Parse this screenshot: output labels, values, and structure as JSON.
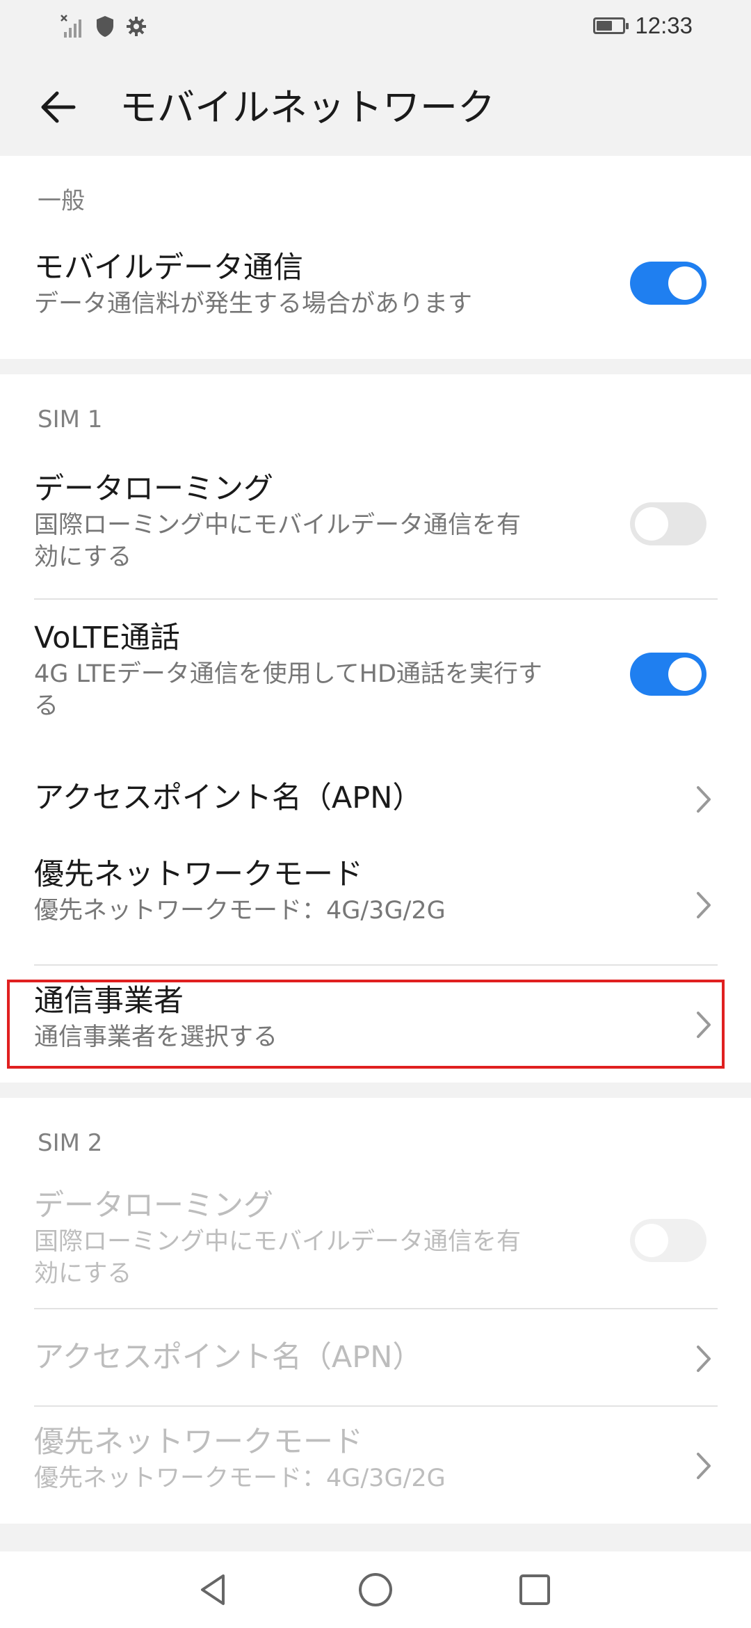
{
  "status_bar": {
    "time": "12:33",
    "icons": [
      "no-signal-icon",
      "shield-icon",
      "gear-icon",
      "battery-icon"
    ]
  },
  "header": {
    "back_icon": "arrow-back-icon",
    "title": "モバイルネットワーク"
  },
  "sections": {
    "general": {
      "title": "一般",
      "mobile_data": {
        "title": "モバイルデータ通信",
        "subtitle": "データ通信料が発生する場合があります",
        "toggle": "on"
      }
    },
    "sim1": {
      "title": "SIM 1",
      "data_roaming": {
        "title": "データローミング",
        "subtitle_line1": "国際ローミング中にモバイルデータ通信を有",
        "subtitle_line2": "効にする",
        "toggle": "off"
      },
      "volte": {
        "title": "VoLTE通話",
        "subtitle_line1": "4G LTEデータ通信を使用してHD通話を実行す",
        "subtitle_line2": "る",
        "toggle": "on"
      },
      "apn": {
        "title": "アクセスポイント名（APN）"
      },
      "preferred_network": {
        "title": "優先ネットワークモード",
        "subtitle": "優先ネットワークモード：4G/3G/2G"
      },
      "carrier": {
        "title": "通信事業者",
        "subtitle": "通信事業者を選択する"
      }
    },
    "sim2": {
      "title": "SIM 2",
      "data_roaming": {
        "title": "データローミング",
        "subtitle_line1": "国際ローミング中にモバイルデータ通信を有",
        "subtitle_line2": "効にする",
        "toggle": "off"
      },
      "apn": {
        "title": "アクセスポイント名（APN）"
      },
      "preferred_network": {
        "title": "優先ネットワークモード",
        "subtitle": "優先ネットワークモード：4G/3G/2G"
      }
    }
  },
  "colors": {
    "accent": "#1f7ff0",
    "highlight": "#e02020",
    "background": "#f2f2f2"
  },
  "nav_bar": {
    "icons": [
      "back-triangle-icon",
      "home-circle-icon",
      "recents-square-icon"
    ]
  }
}
